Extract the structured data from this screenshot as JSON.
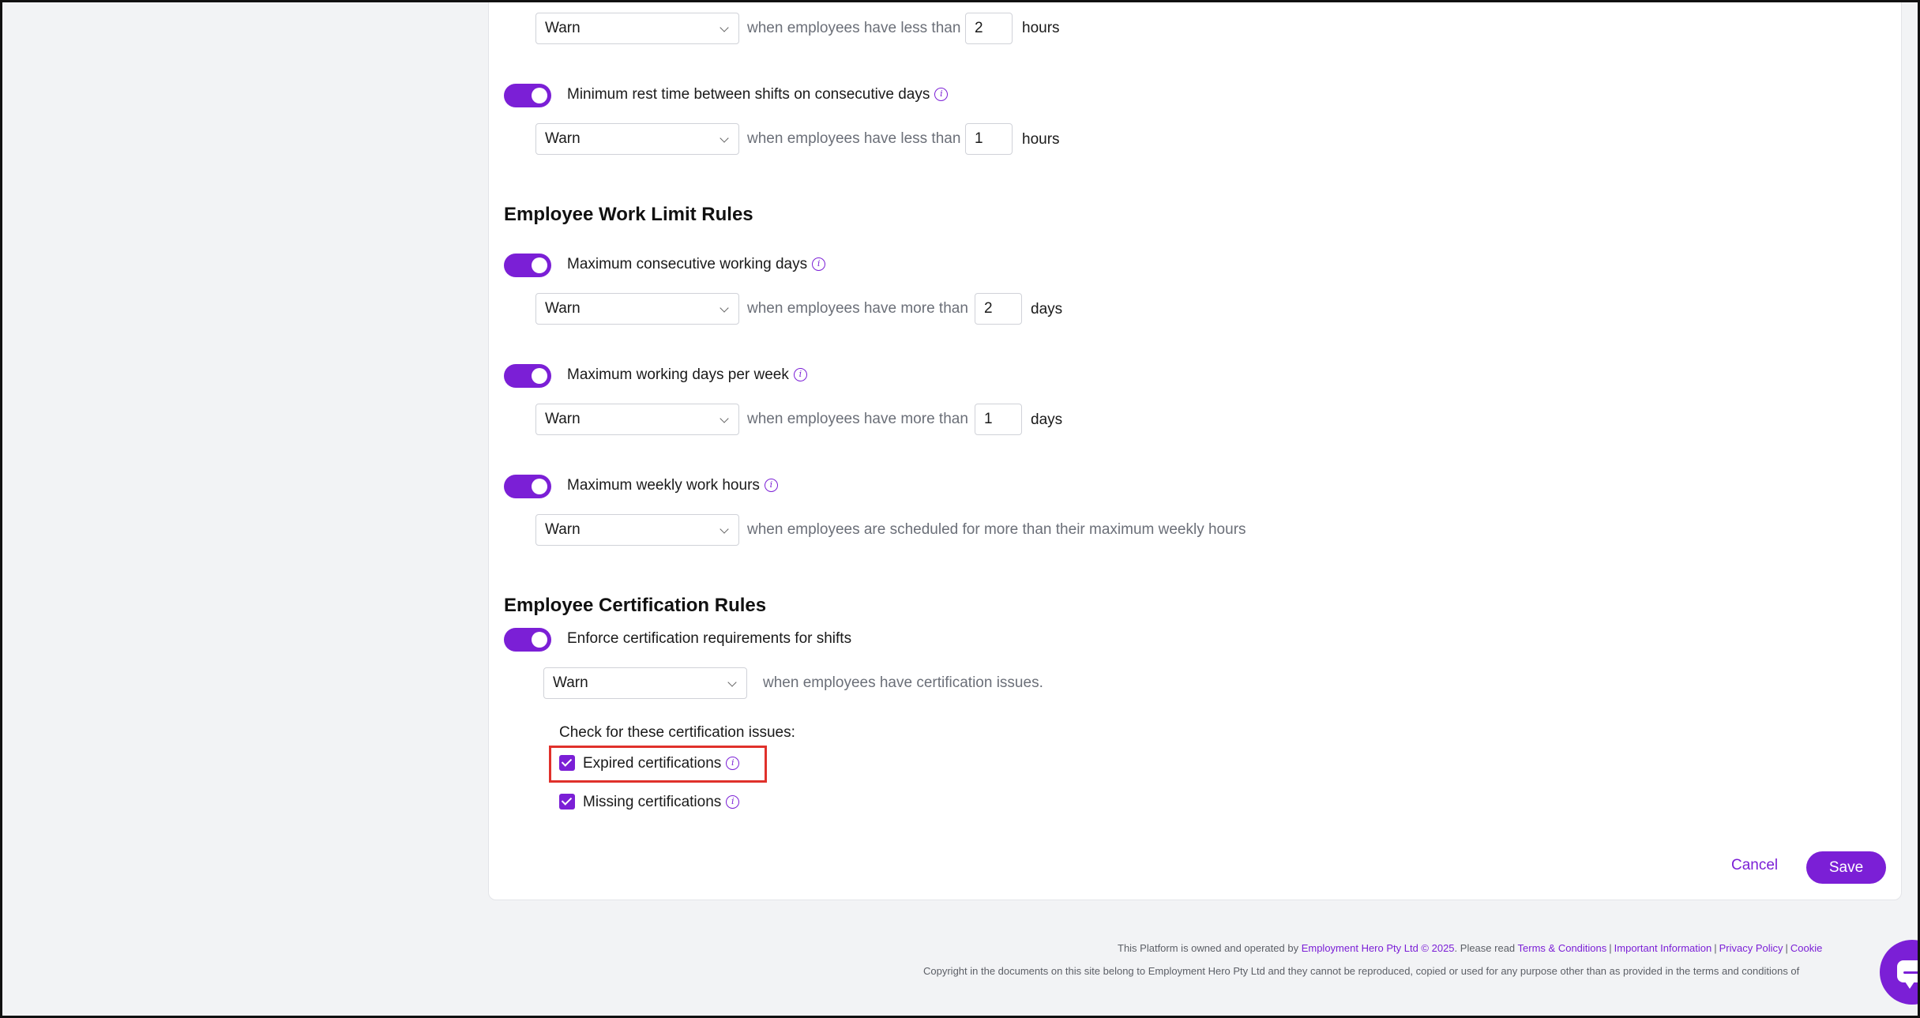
{
  "rules": [
    {
      "id": "r0",
      "select": "Warn",
      "desc_before": "when employees have less than",
      "value": "2",
      "unit": "hours"
    },
    {
      "id": "r1",
      "title": "Minimum rest time between shifts on consecutive days",
      "select": "Warn",
      "desc_before": "when employees have less than",
      "value": "1",
      "unit": "hours"
    }
  ],
  "work_limit": {
    "heading": "Employee Work Limit Rules",
    "rules": [
      {
        "title": "Maximum consecutive working days",
        "select": "Warn",
        "desc_before": "when employees have more than",
        "value": "2",
        "unit": "days"
      },
      {
        "title": "Maximum working days per week",
        "select": "Warn",
        "desc_before": "when employees have more than",
        "value": "1",
        "unit": "days"
      },
      {
        "title": "Maximum weekly work hours",
        "select": "Warn",
        "desc_before": "when employees are scheduled for more than their maximum weekly hours"
      }
    ]
  },
  "certification": {
    "heading": "Employee Certification Rules",
    "toggle_label": "Enforce certification requirements for shifts",
    "select": "Warn",
    "desc": "when employees have certification issues.",
    "check_heading": "Check for these certification issues:",
    "checks": [
      {
        "label": "Expired certifications",
        "checked": true
      },
      {
        "label": "Missing certifications",
        "checked": true
      }
    ]
  },
  "actions": {
    "cancel": "Cancel",
    "save": "Save"
  },
  "footer": {
    "line1_prefix": "This Platform is owned and operated by",
    "company_link": "Employment Hero Pty Ltd © 2025",
    "line1_mid": ". Please read",
    "terms": "Terms & Conditions",
    "important": "Important Information",
    "privacy": "Privacy Policy",
    "cookie": "Cookie",
    "line2": "Copyright in the documents on this site belong to Employment Hero Pty Ltd and they cannot be reproduced, copied or used for any purpose other than as provided in the terms and conditions of"
  },
  "info_glyph": "i",
  "colors": {
    "accent": "#7b1fd6",
    "highlight": "#e0312b"
  }
}
